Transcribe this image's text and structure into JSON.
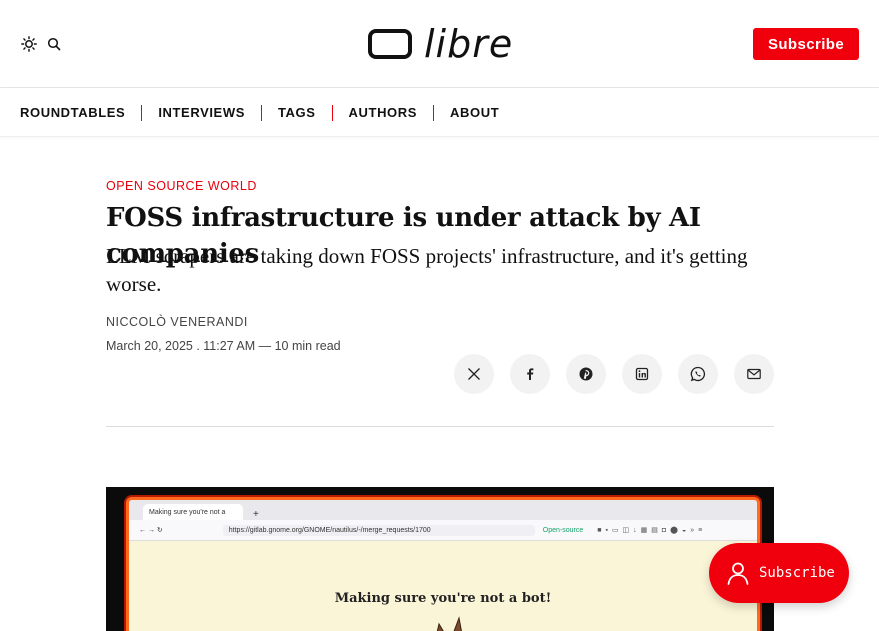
{
  "header": {
    "logo_text": "libre",
    "subscribe_label": "Subscribe",
    "theme_icon": "sun-icon",
    "search_icon": "search-icon",
    "brand_color": "#f0000c"
  },
  "nav": {
    "items": [
      {
        "label": "ROUNDTABLES"
      },
      {
        "label": "INTERVIEWS"
      },
      {
        "label": "TAGS"
      },
      {
        "label": "AUTHORS"
      },
      {
        "label": "ABOUT"
      }
    ]
  },
  "article": {
    "category": "OPEN SOURCE WORLD",
    "title": "FOSS infrastructure is under attack by AI companies",
    "subtitle": "LLM scrapers are taking down FOSS projects' infrastructure, and it's getting worse.",
    "author": "NICCOLÒ VENERANDI",
    "meta": "March 20, 2025 . 11:27 AM — 10 min read",
    "share_icons": [
      "x-icon",
      "facebook-icon",
      "pinterest-icon",
      "linkedin-icon",
      "whatsapp-icon",
      "email-icon"
    ]
  },
  "feature_image": {
    "tab_title": "Making sure you're not a",
    "url": "https://gitlab.gnome.org/GNOME/nautilus/-/merge_requests/1700",
    "extension_label": "Open-source",
    "heading": "Making sure you're not a bot!"
  },
  "portal": {
    "label": "Subscribe"
  }
}
